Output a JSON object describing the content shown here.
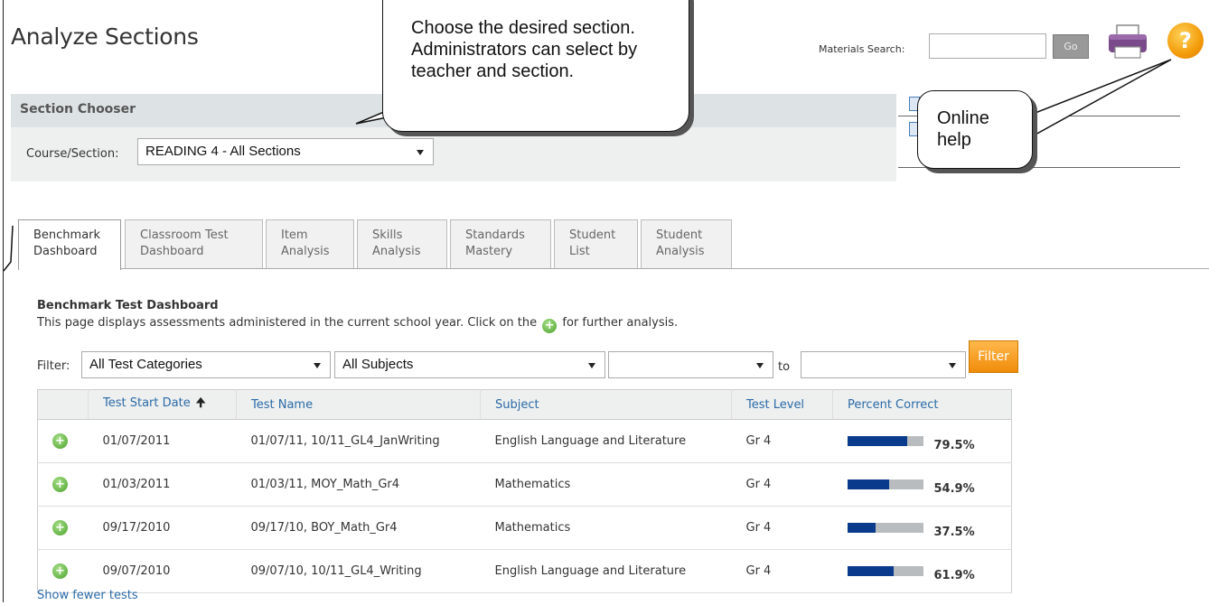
{
  "page": {
    "title": "Analyze Sections"
  },
  "header": {
    "materials_search_label": "Materials Search:",
    "materials_search_value": "",
    "go_label": "Go",
    "help_glyph": "?"
  },
  "section_chooser": {
    "title": "Section Chooser",
    "course_label": "Course/Section:",
    "course_value": "READING 4 - All Sections"
  },
  "callouts": {
    "section": "Choose the desired section. Administrators can select by teacher and section.",
    "help": "Online help"
  },
  "tabs": [
    {
      "line1": "Benchmark",
      "line2": "Dashboard",
      "active": true
    },
    {
      "line1": "Classroom Test",
      "line2": "Dashboard",
      "active": false
    },
    {
      "line1": "Item",
      "line2": "Analysis",
      "active": false
    },
    {
      "line1": "Skills",
      "line2": "Analysis",
      "active": false
    },
    {
      "line1": "Standards",
      "line2": "Mastery",
      "active": false
    },
    {
      "line1": "Student",
      "line2": "List",
      "active": false
    },
    {
      "line1": "Student",
      "line2": "Analysis",
      "active": false
    }
  ],
  "dashboard": {
    "title": "Benchmark Test Dashboard",
    "desc_before": "This page displays assessments administered in the current school year. Click on the",
    "desc_after": "for further analysis.",
    "filter_label": "Filter:",
    "category_value": "All Test Categories",
    "subject_value": "All Subjects",
    "date_from_value": "",
    "to_label": "to",
    "date_to_value": "",
    "filter_button": "Filter"
  },
  "table": {
    "columns": [
      "Test Start Date",
      "Test Name",
      "Subject",
      "Test Level",
      "Percent Correct"
    ],
    "rows": [
      {
        "date": "01/07/2011",
        "name": "01/07/11, 10/11_GL4_JanWriting",
        "subject": "English Language and Literature",
        "level": "Gr 4",
        "percent": "79.5%",
        "fraction": 0.795
      },
      {
        "date": "01/03/2011",
        "name": "01/03/11, MOY_Math_Gr4",
        "subject": "Mathematics",
        "level": "Gr 4",
        "percent": "54.9%",
        "fraction": 0.549
      },
      {
        "date": "09/17/2010",
        "name": "09/17/10, BOY_Math_Gr4",
        "subject": "Mathematics",
        "level": "Gr 4",
        "percent": "37.5%",
        "fraction": 0.375
      },
      {
        "date": "09/07/2010",
        "name": "09/07/10, 10/11_GL4_Writing",
        "subject": "English Language and Literature",
        "level": "Gr 4",
        "percent": "61.9%",
        "fraction": 0.619
      }
    ]
  },
  "footer": {
    "show_fewer": "Show fewer tests"
  },
  "colors": {
    "link": "#2a6aa6",
    "bar_fill": "#0a3a8c",
    "bar_bg": "#b8bcbf",
    "filter_btn": "#f39b0a",
    "header_band": "#dde3e4"
  }
}
